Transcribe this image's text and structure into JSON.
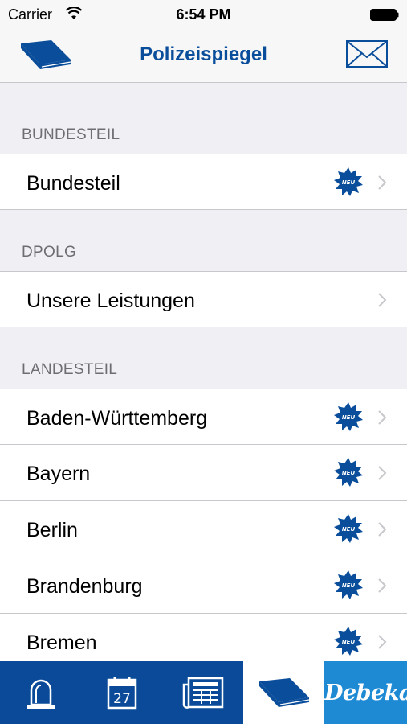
{
  "status_bar": {
    "carrier": "Carrier",
    "time": "6:54 PM"
  },
  "nav": {
    "title": "Polizeispiegel",
    "left_icon": "book-icon",
    "right_icon": "mail-icon"
  },
  "sections": [
    {
      "header": "BUNDESTEIL",
      "rows": [
        {
          "label": "Bundesteil",
          "new": true
        }
      ]
    },
    {
      "header": "DPOLG",
      "rows": [
        {
          "label": "Unsere Leistungen",
          "new": false
        }
      ]
    },
    {
      "header": "LANDESTEIL",
      "rows": [
        {
          "label": "Baden-Württemberg",
          "new": true
        },
        {
          "label": "Bayern",
          "new": true
        },
        {
          "label": "Berlin",
          "new": true
        },
        {
          "label": "Brandenburg",
          "new": true
        },
        {
          "label": "Bremen",
          "new": true
        }
      ]
    }
  ],
  "badge_text": "NEU",
  "tab_bar": {
    "tabs": [
      {
        "icon": "siren-icon"
      },
      {
        "icon": "calendar-icon",
        "text": "27"
      },
      {
        "icon": "newspaper-icon"
      },
      {
        "icon": "book-icon",
        "active": true
      },
      {
        "icon": "debeka-logo",
        "text": "Debeka"
      }
    ]
  },
  "colors": {
    "brand_blue": "#0a4e9b",
    "tabbar_blue": "#0a4a98",
    "debeka_blue": "#1f8ad4"
  }
}
